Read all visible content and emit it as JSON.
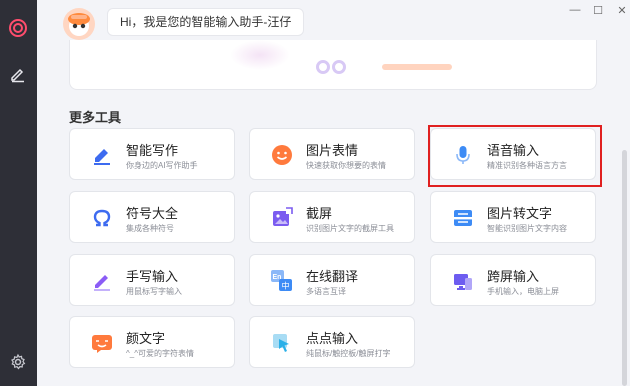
{
  "header": {
    "greeting": "Hi，我是您的智能输入助手-汪仔"
  },
  "window_controls": {
    "minimize": "—",
    "maximize": "☐",
    "close": "✕"
  },
  "section_title": "更多工具",
  "tools": [
    {
      "title": "智能写作",
      "desc": "你身边的AI写作助手",
      "icon": "pen-edit-icon",
      "color": "#3d6bf0"
    },
    {
      "title": "图片表情",
      "desc": "快速获取你想要的表情",
      "icon": "smiley-icon",
      "color": "#ff7a3d"
    },
    {
      "title": "语音输入",
      "desc": "精准识别各种语言方言",
      "icon": "microphone-icon",
      "color": "#3d8bf5"
    },
    {
      "title": "符号大全",
      "desc": "集成各种符号",
      "icon": "omega-icon",
      "color": "#3d6bf0"
    },
    {
      "title": "截屏",
      "desc": "识别图片文字的截屏工具",
      "icon": "screenshot-icon",
      "color": "#7b5cf0"
    },
    {
      "title": "图片转文字",
      "desc": "智能识别图片文字内容",
      "icon": "image-to-text-icon",
      "color": "#3d8bf5"
    },
    {
      "title": "手写输入",
      "desc": "用鼠标写字输入",
      "icon": "pencil-icon",
      "color": "#8b5cf6"
    },
    {
      "title": "在线翻译",
      "desc": "多语言互译",
      "icon": "translate-icon",
      "color": "#3d8bf5"
    },
    {
      "title": "跨屏输入",
      "desc": "手机输入，电脑上屏",
      "icon": "cross-screen-icon",
      "color": "#6d5cf0"
    },
    {
      "title": "颜文字",
      "desc": "^_^可爱的字符表情",
      "icon": "kaomoji-icon",
      "color": "#ff7a3d"
    },
    {
      "title": "点点输入",
      "desc": "纯鼠标/触控板/触屏打字",
      "icon": "cursor-click-icon",
      "color": "#2bb0e8"
    }
  ]
}
